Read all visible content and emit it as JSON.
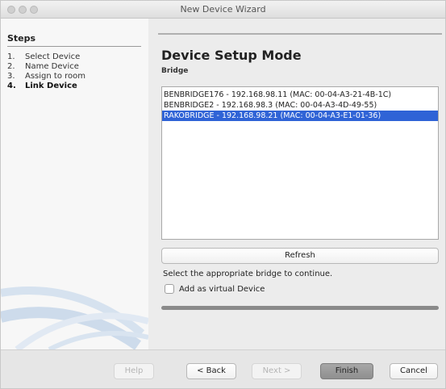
{
  "window": {
    "title": "New Device Wizard"
  },
  "steps": {
    "title": "Steps",
    "items": [
      {
        "num": "1.",
        "label": "Select Device"
      },
      {
        "num": "2.",
        "label": "Name Device"
      },
      {
        "num": "3.",
        "label": "Assign to room"
      },
      {
        "num": "4.",
        "label": "Link Device"
      }
    ],
    "active_index": 3
  },
  "main": {
    "heading": "Device Setup Mode",
    "subheading": "Bridge",
    "bridges": [
      "BENBRIDGE176 - 192.168.98.11 (MAC: 00-04-A3-21-4B-1C)",
      "BENBRIDGE2 - 192.168.98.3 (MAC: 00-04-A3-4D-49-55)",
      "RAKOBRIDGE - 192.168.98.21 (MAC: 00-04-A3-E1-01-36)"
    ],
    "selected_bridge_index": 2,
    "refresh_label": "Refresh",
    "hint": "Select the appropriate bridge to continue.",
    "virtual_checkbox_label": "Add as virtual Device",
    "virtual_checked": false,
    "progress": 1.0
  },
  "footer": {
    "help": "Help",
    "back": "< Back",
    "next": "Next >",
    "finish": "Finish",
    "cancel": "Cancel"
  },
  "colors": {
    "selection": "#2f63d6",
    "finish_button": "#9a9a9a"
  }
}
